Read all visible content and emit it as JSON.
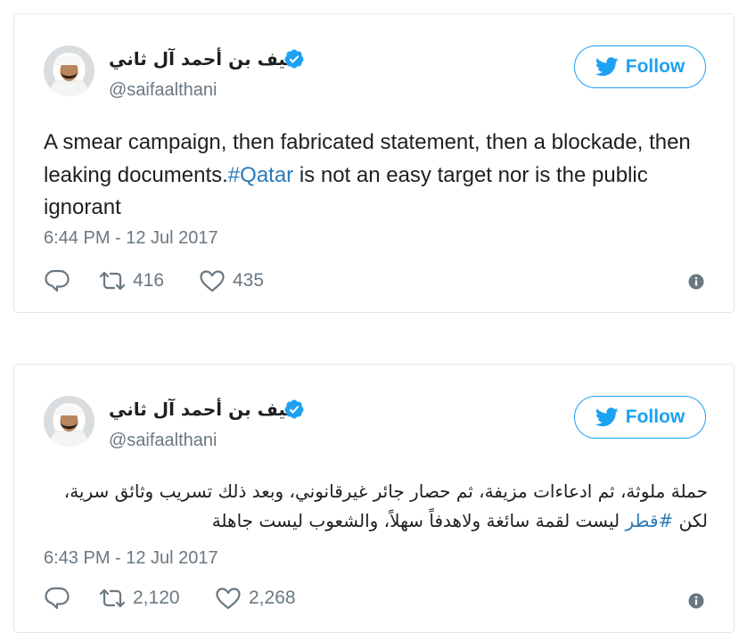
{
  "colors": {
    "accent": "#1da1f2",
    "hashtag": "#2b7bb9",
    "text": "#1c2022",
    "secondary": "#697882",
    "border": "#e1e8ed"
  },
  "tweets": [
    {
      "author_name": "سيف بن أحمد آل ثاني",
      "handle": "@saifaalthani",
      "verified_icon": "verified-badge-icon",
      "follow_label": "Follow",
      "text_before": "A smear campaign, then fabricated statement, then a blockade, then leaking documents.",
      "hashtag": "#Qatar",
      "text_after": " is not an easy target nor is the public ignorant",
      "timestamp": "6:44 PM - 12 Jul 2017",
      "retweets": "416",
      "likes": "435"
    },
    {
      "author_name": "سيف بن أحمد آل ثاني",
      "handle": "@saifaalthani",
      "verified_icon": "verified-badge-icon",
      "follow_label": "Follow",
      "text_before": "حملة ملوثة، ثم ادعاءات مزيفة، ثم حصار جائر غيرقانوني، وبعد ذلك تسريب وثائق سرية، لكن ",
      "hashtag": "#قطر",
      "text_after": " ليست لقمة سائغة ولاهدفاً سهلاً، والشعوب ليست جاهلة",
      "timestamp": "6:43 PM - 12 Jul 2017",
      "retweets": "2,120",
      "likes": "2,268"
    }
  ]
}
